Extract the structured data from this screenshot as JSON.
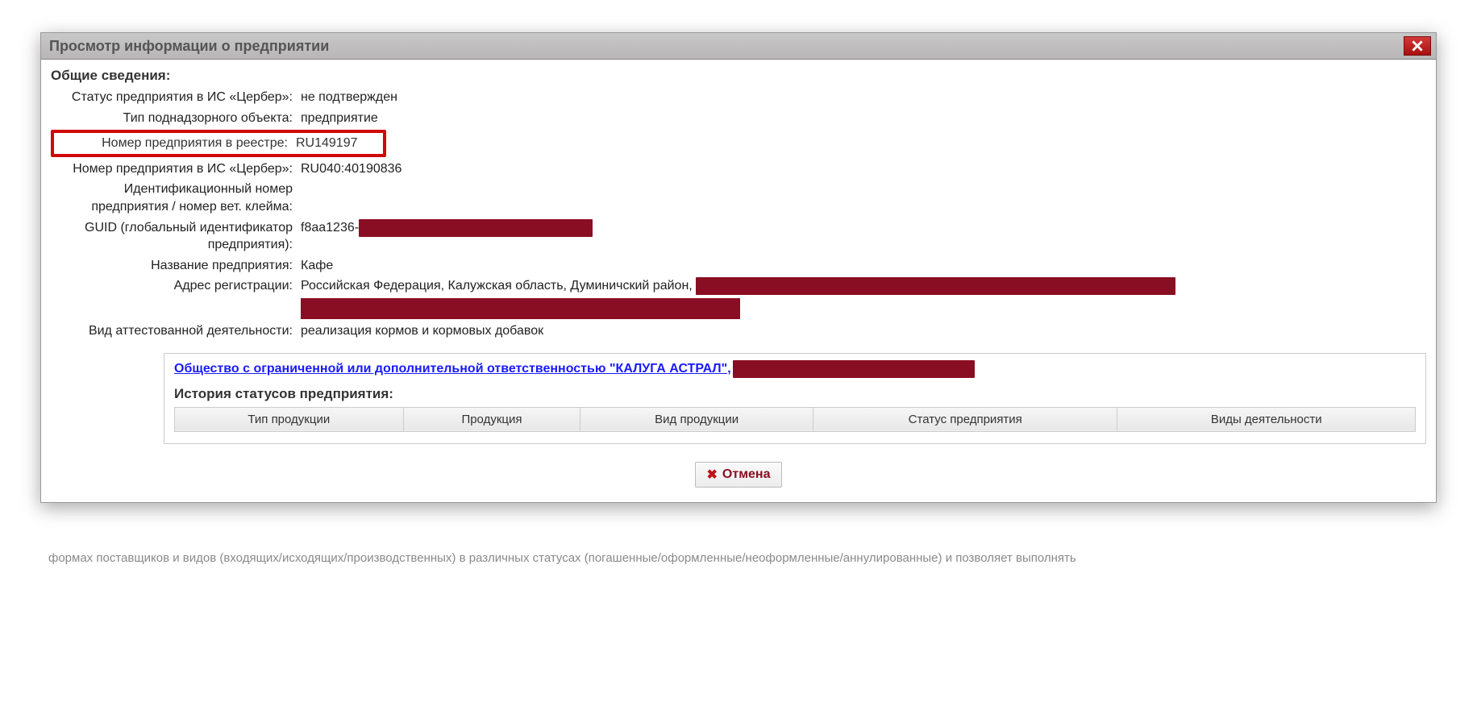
{
  "dialog": {
    "title": "Просмотр информации о предприятии",
    "section_title": "Общие сведения:",
    "rows": {
      "status_label": "Статус предприятия в ИС «Цербер»:",
      "status_value": "не подтвержден",
      "type_label": "Тип поднадзорного объекта:",
      "type_value": "предприятие",
      "reg_num_label": "Номер предприятия в реестре:",
      "reg_num_value": "RU149197",
      "cerber_num_label": "Номер предприятия в ИС «Цербер»:",
      "cerber_num_value": "RU040:40190836",
      "id_num_label": "Идентификационный номер предприятия / номер вет. клейма:",
      "id_num_value": "",
      "guid_label": "GUID (глобальный идентификатор предприятия):",
      "guid_value_visible": "f8aa1236-",
      "name_label": "Название предприятия:",
      "name_value": "Кафе",
      "address_label": "Адрес регистрации:",
      "address_value_visible": "Российская Федерация, Калужская область, Думиничский район,",
      "activity_label": "Вид аттестованной деятельности:",
      "activity_value": "реализация кормов и кормовых добавок"
    },
    "company_link": "Общество с ограниченной или дополнительной ответственностью \"КАЛУГА АСТРАЛ\",",
    "history_title": "История статусов предприятия:",
    "history_headers": [
      "Тип продукции",
      "Продукция",
      "Вид продукции",
      "Статус предприятия",
      "Виды деятельности"
    ],
    "cancel_label": "Отмена"
  },
  "background_text": "формах поставщиков и видов (входящих/исходящих/производственных) в различных статусах (погашенные/оформленные/неоформленные/аннулированные) и позволяет выполнять"
}
